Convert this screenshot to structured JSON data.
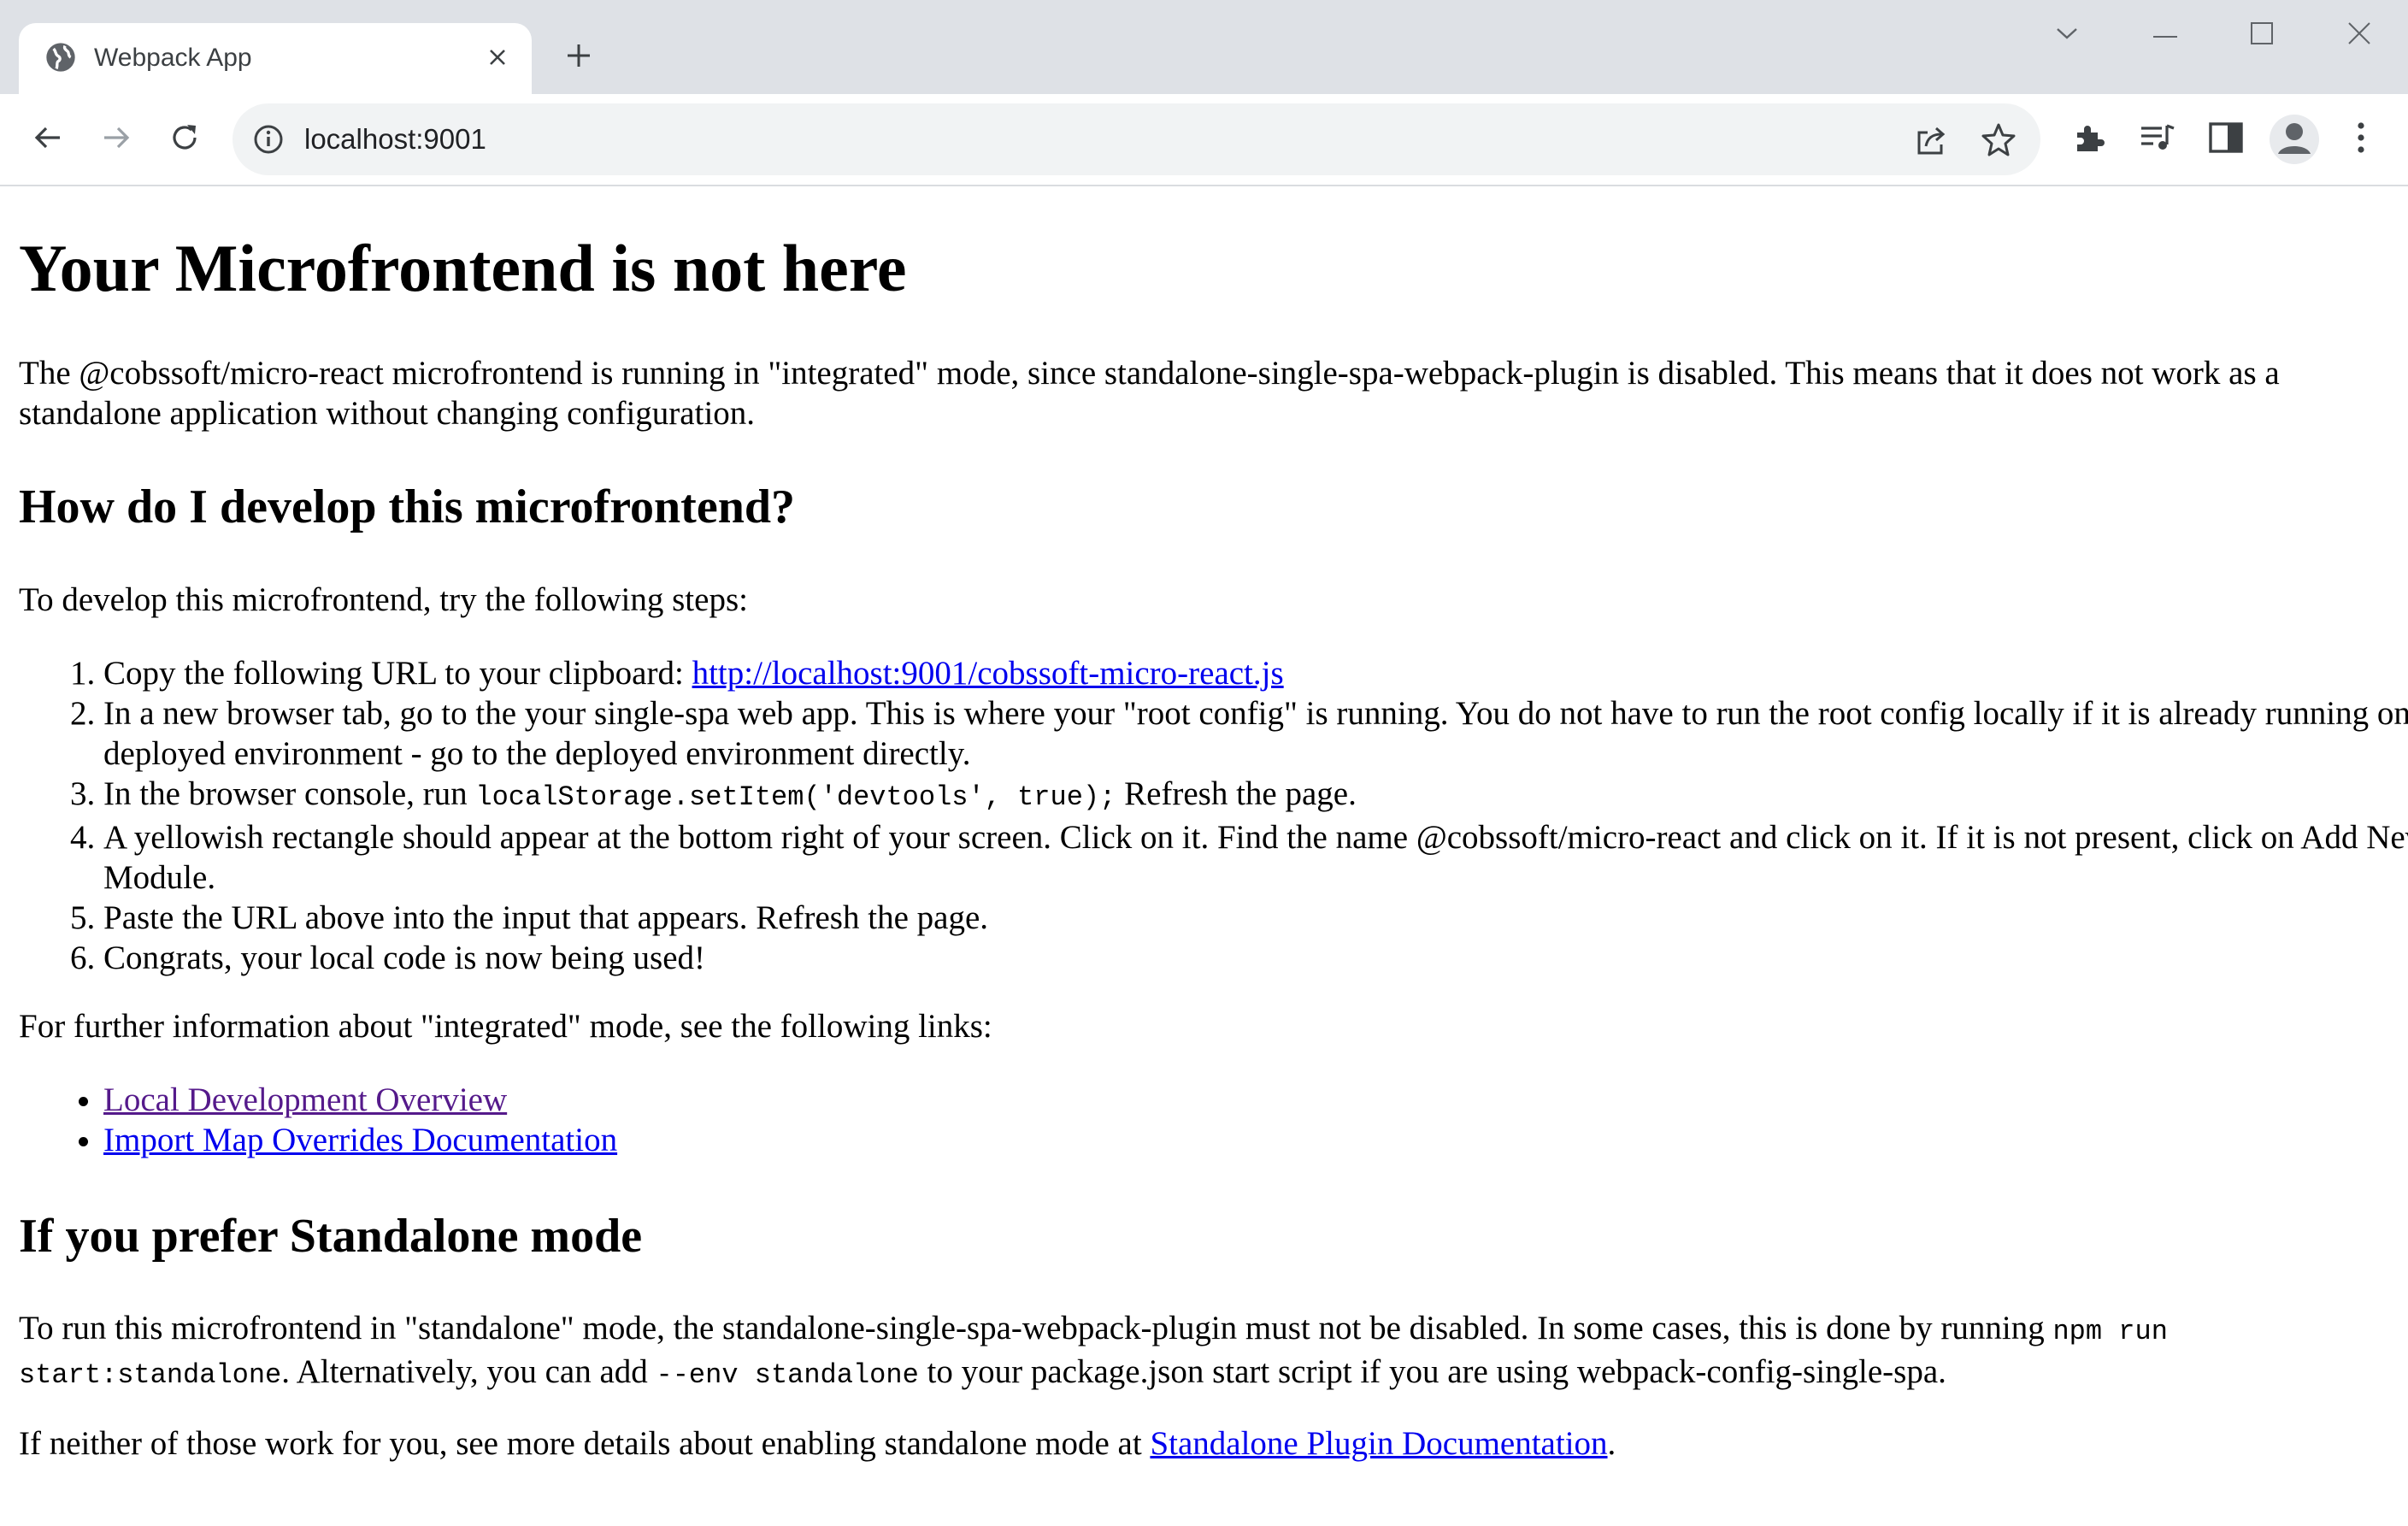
{
  "browser": {
    "tab": {
      "title": "Webpack App"
    },
    "address_bar": {
      "url": "localhost:9001"
    },
    "icons": {
      "favicon": "globe-icon",
      "tab_close": "close-icon",
      "new_tab": "plus-icon",
      "back": "arrow-left-icon",
      "forward": "arrow-right-icon",
      "reload": "reload-icon",
      "site_info": "info-icon",
      "share": "share-icon",
      "bookmark": "star-icon",
      "extensions": "puzzle-icon",
      "media": "media-queue-icon",
      "side_panel": "side-panel-icon",
      "profile": "avatar-icon",
      "menu": "kebab-menu-icon",
      "tab_search": "chevron-down-icon",
      "minimize": "minimize-icon",
      "maximize": "maximize-icon",
      "close": "close-icon"
    }
  },
  "content": {
    "title": "Your Microfrontend is not here",
    "intro": "The @cobssoft/micro-react microfrontend is running in \"integrated\" mode, since standalone-single-spa-webpack-plugin is disabled. This means that it does not work as a standalone application without changing configuration.",
    "develop_heading": "How do I develop this microfrontend?",
    "develop_intro": "To develop this microfrontend, try the following steps:",
    "steps": {
      "s1_text": "Copy the following URL to your clipboard: ",
      "s1_link": "http://localhost:9001/cobssoft-micro-react.js",
      "s2": "In a new browser tab, go to the your single-spa web app. This is where your \"root config\" is running. You do not have to run the root config locally if it is already running on a deployed environment - go to the deployed environment directly.",
      "s3_pre": "In the browser console, run ",
      "s3_code": "localStorage.setItem('devtools', true);",
      "s3_post": " Refresh the page.",
      "s4": "A yellowish rectangle should appear at the bottom right of your screen. Click on it. Find the name @cobssoft/micro-react and click on it. If it is not present, click on Add New Module.",
      "s5": "Paste the URL above into the input that appears. Refresh the page.",
      "s6": "Congrats, your local code is now being used!"
    },
    "further_info": "For further information about \"integrated\" mode, see the following links:",
    "links": {
      "local_dev": "Local Development Overview",
      "import_map": "Import Map Overrides Documentation"
    },
    "standalone_heading": "If you prefer Standalone mode",
    "standalone_p": {
      "pre": "To run this microfrontend in \"standalone\" mode, the standalone-single-spa-webpack-plugin must not be disabled. In some cases, this is done by running ",
      "code1": "npm run start:standalone",
      "mid": ". Alternatively, you can add ",
      "code2": "--env standalone",
      "post": " to your package.json start script if you are using webpack-config-single-spa."
    },
    "neither_p": {
      "pre": "If neither of those work for you, see more details about enabling standalone mode at ",
      "link": "Standalone Plugin Documentation",
      "post": "."
    }
  }
}
